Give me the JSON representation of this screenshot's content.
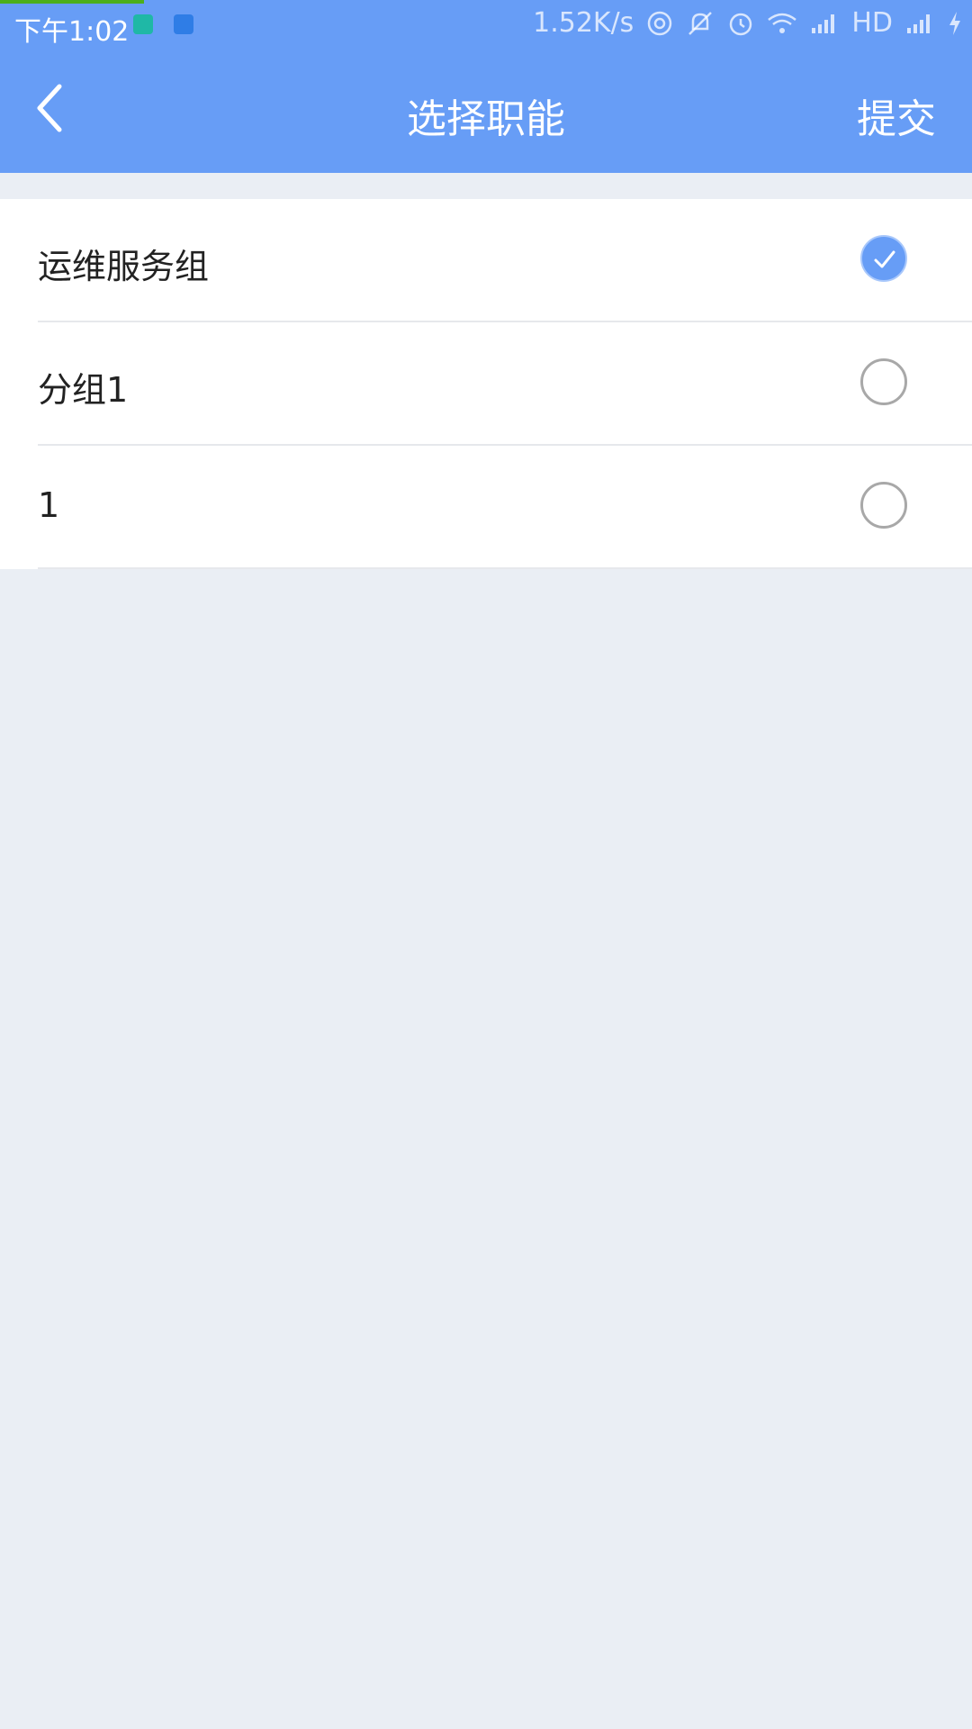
{
  "status_bar": {
    "time": "下午1:02",
    "net_speed": "1.52K/s",
    "network_label": "HD",
    "icons": [
      "hotspot-icon",
      "mute-icon",
      "alarm-icon",
      "wifi-icon",
      "signal-icon",
      "signal-icon",
      "charging-icon"
    ],
    "app_icon_colors": [
      "#1fb8a6",
      "#2f7de6"
    ]
  },
  "header": {
    "title": "选择职能",
    "submit_label": "提交",
    "back_icon": "chevron-left-icon"
  },
  "colors": {
    "primary": "#679df6",
    "background": "#eaeef4",
    "progress": "#4caf1c"
  },
  "options": [
    {
      "label": "运维服务组",
      "selected": true
    },
    {
      "label": "分组1",
      "selected": false
    },
    {
      "label": "1",
      "selected": false
    }
  ]
}
